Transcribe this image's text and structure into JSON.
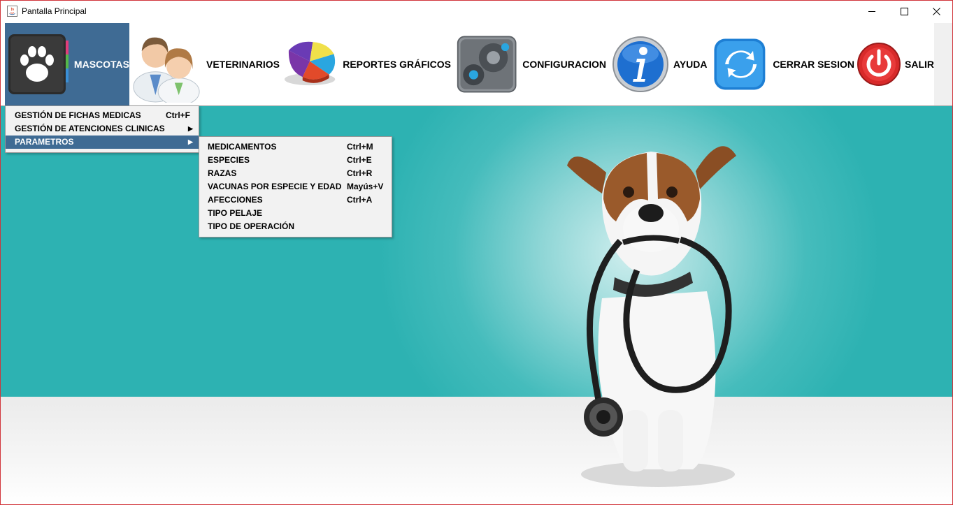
{
  "window": {
    "title": "Pantalla Principal"
  },
  "menubar": {
    "menus": [
      {
        "label": "MASCOTAS",
        "icon": "paw-icon",
        "active": true
      },
      {
        "label": "VETERINARIOS",
        "icon": "doctors-icon"
      },
      {
        "label": "REPORTES GRÁFICOS",
        "icon": "pie-chart-icon"
      },
      {
        "label": "CONFIGURACION",
        "icon": "gears-icon"
      },
      {
        "label": "AYUDA",
        "icon": "info-icon"
      },
      {
        "label": "CERRAR SESION",
        "icon": "refresh-icon"
      },
      {
        "label": "SALIR",
        "icon": "power-icon"
      }
    ]
  },
  "mascotas_menu": {
    "items": [
      {
        "label": "GESTIÓN DE FICHAS MEDICAS",
        "accel": "Ctrl+F"
      },
      {
        "label": "GESTIÓN DE ATENCIONES CLINICAS",
        "submenu": true
      },
      {
        "label": "PARAMETROS",
        "submenu": true,
        "selected": true
      }
    ]
  },
  "parametros_menu": {
    "items": [
      {
        "label": "MEDICAMENTOS",
        "accel": "Ctrl+M"
      },
      {
        "label": "ESPECIES",
        "accel": "Ctrl+E"
      },
      {
        "label": "RAZAS",
        "accel": "Ctrl+R"
      },
      {
        "label": "VACUNAS POR ESPECIE Y EDAD",
        "accel": "Mayús+V"
      },
      {
        "label": "AFECCIONES",
        "accel": "Ctrl+A"
      },
      {
        "label": "TIPO PELAJE",
        "accel": ""
      },
      {
        "label": "TIPO DE OPERACIÓN",
        "accel": ""
      }
    ]
  },
  "colors": {
    "accent": "#3f6b94",
    "window_border": "#d1343a",
    "teal": "#2db2b2"
  }
}
